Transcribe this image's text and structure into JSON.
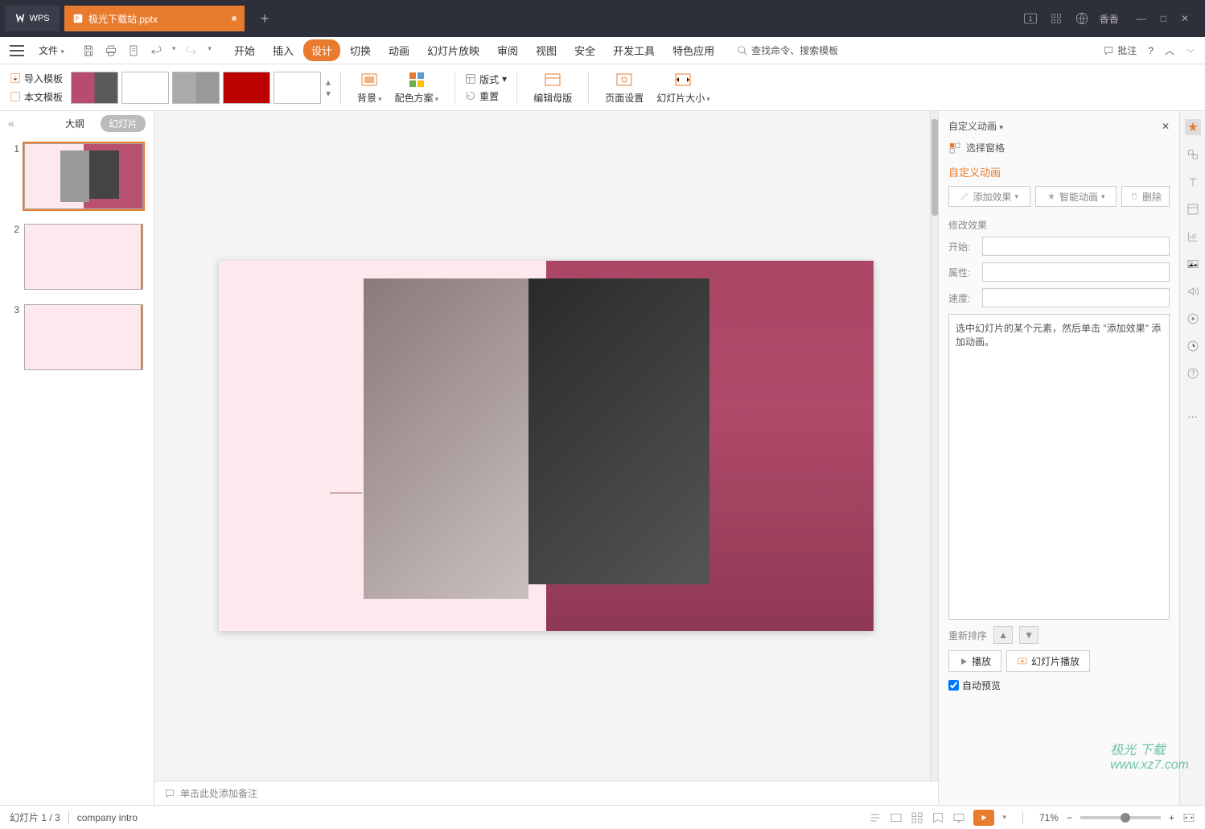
{
  "titlebar": {
    "wps": "WPS",
    "tab_name": "极光下载站.pptx",
    "user": "香香"
  },
  "menubar": {
    "file": "文件",
    "items": [
      "开始",
      "插入",
      "设计",
      "切换",
      "动画",
      "幻灯片放映",
      "审阅",
      "视图",
      "安全",
      "开发工具",
      "特色应用"
    ],
    "active": "设计",
    "search": "查找命令、搜索模板",
    "annotate": "批注"
  },
  "ribbon": {
    "import_tpl": "导入模板",
    "local_tpl": "本文模板",
    "bg": "背景",
    "color_scheme": "配色方案",
    "layout": "版式",
    "reset": "重置",
    "edit_master": "编辑母版",
    "page_setup": "页面设置",
    "slide_size": "幻灯片大小"
  },
  "leftpane": {
    "outline": "大纲",
    "slides": "幻灯片"
  },
  "notes": {
    "placeholder": "单击此处添加备注"
  },
  "rightpane": {
    "title": "自定义动画",
    "select_pane": "选择窗格",
    "subtitle": "自定义动画",
    "add_effect": "添加效果",
    "smart_anim": "智能动画",
    "delete": "删除",
    "modify": "修改效果",
    "start": "开始:",
    "property": "属性:",
    "speed": "速度:",
    "hint": "选中幻灯片的某个元素，然后单击 \"添加效果\" 添加动画。",
    "reorder": "重新排序",
    "play": "播放",
    "slideshow_play": "幻灯片播放",
    "auto_preview": "自动预览"
  },
  "statusbar": {
    "slide_info": "幻灯片 1 / 3",
    "template": "company intro",
    "zoom": "71%"
  },
  "watermark": {
    "site": "www.xz7.com",
    "brand": "极光 下载"
  }
}
